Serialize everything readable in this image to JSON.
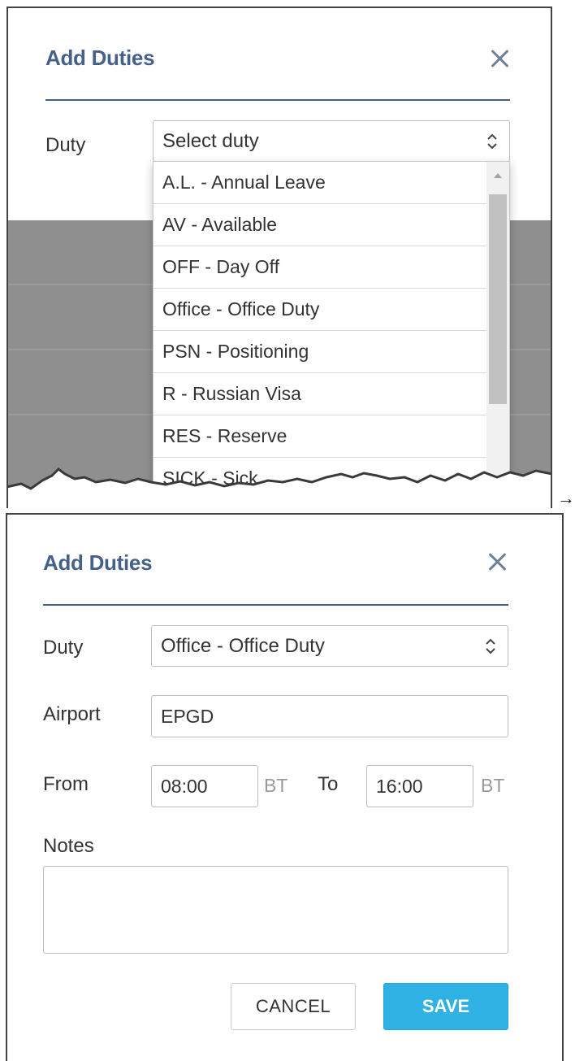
{
  "transition_arrow": "→",
  "panel1": {
    "title": "Add Duties",
    "duty_label": "Duty",
    "duty_placeholder": "Select duty",
    "dropdown_items": [
      {
        "label": "A.L. - Annual Leave"
      },
      {
        "label": "AV - Available"
      },
      {
        "label": "OFF - Day Off"
      },
      {
        "label": "Office - Office Duty"
      },
      {
        "label": "PSN - Positioning"
      },
      {
        "label": "R - Russian Visa"
      },
      {
        "label": "RES - Reserve"
      },
      {
        "label": "SICK - Sick"
      }
    ]
  },
  "panel2": {
    "title": "Add Duties",
    "duty_label": "Duty",
    "duty_value": "Office - Office Duty",
    "airport_label": "Airport",
    "airport_value": "EPGD",
    "from_label": "From",
    "from_value": "08:00",
    "from_unit": "BT",
    "to_label": "To",
    "to_value": "16:00",
    "to_unit": "BT",
    "notes_label": "Notes",
    "notes_value": "",
    "cancel_label": "CANCEL",
    "save_label": "SAVE"
  },
  "colors": {
    "title": "#45618a",
    "divider": "#45618a",
    "save_button": "#2fb1e3",
    "backdrop": "#8f8f8f"
  },
  "icons": {
    "close": "close-icon",
    "select_arrows": "sort-arrows-icon",
    "resize": "resize-grip-icon"
  }
}
